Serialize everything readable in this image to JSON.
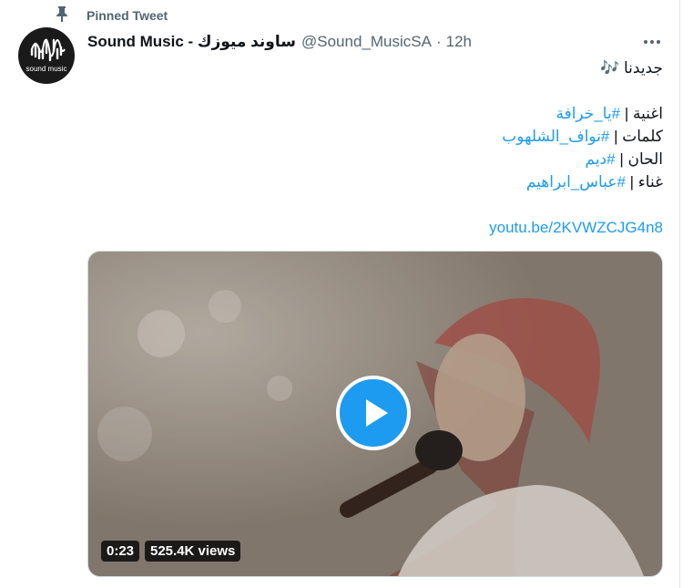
{
  "pinned": {
    "label": "Pinned Tweet"
  },
  "tweet": {
    "author": {
      "display_name": "Sound Music - ساوند ميوزك",
      "handle": "@Sound_MusicSA",
      "separator": "·",
      "time": "12h",
      "avatar_caption": "sound music"
    },
    "lines": [
      {
        "text": "جديدنا ",
        "emoji": "🎶"
      },
      {
        "label": "اغنية | ",
        "hashtag": "#يا_خرافة"
      },
      {
        "label": "كلمات | ",
        "hashtag": "#نواف_الشلهوب"
      },
      {
        "label": "الحان | ",
        "hashtag": "#ديم"
      },
      {
        "label": "غناء | ",
        "hashtag": "#عباس_ابراهيم"
      }
    ],
    "link": "youtu.be/2KVWZCJG4n8",
    "media": {
      "duration": "0:23",
      "views": "525.4K views"
    }
  },
  "colors": {
    "accent": "#1d9bf0",
    "muted": "#536471",
    "text": "#0f1419"
  },
  "icons": {
    "pin": "pin-icon",
    "more": "more-icon",
    "play": "play-icon"
  }
}
